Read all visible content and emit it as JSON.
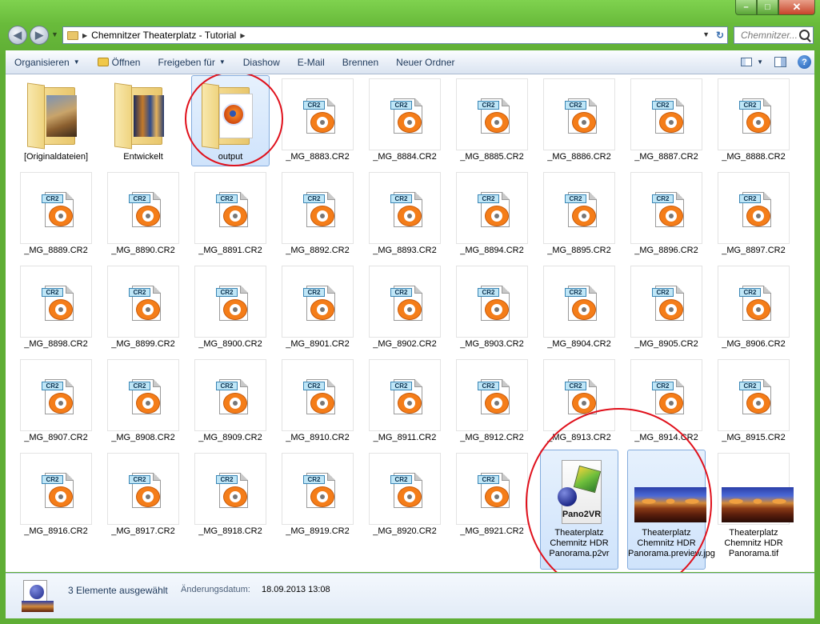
{
  "window": {
    "min_icon": "minimize-icon",
    "max_icon": "maximize-icon",
    "close_icon": "close-icon"
  },
  "nav": {
    "breadcrumb": [
      "Chemnitzer Theaterplatz - Tutorial"
    ],
    "search_placeholder": "Chemnitzer..."
  },
  "toolbar": {
    "items": [
      {
        "label": "Organisieren",
        "caret": true
      },
      {
        "label": "Öffnen",
        "icon": "open-icon"
      },
      {
        "label": "Freigeben für",
        "caret": true
      },
      {
        "label": "Diashow"
      },
      {
        "label": "E-Mail"
      },
      {
        "label": "Brennen"
      },
      {
        "label": "Neuer Ordner"
      }
    ],
    "help": "?"
  },
  "files": [
    {
      "label": "[Originaldateien]",
      "type": "folder-photo"
    },
    {
      "label": "Entwickelt",
      "type": "folder-photo-dark"
    },
    {
      "label": "output",
      "type": "folder-firefox",
      "selected": true
    },
    {
      "label": "_MG_8883.CR2",
      "type": "cr2"
    },
    {
      "label": "_MG_8884.CR2",
      "type": "cr2"
    },
    {
      "label": "_MG_8885.CR2",
      "type": "cr2"
    },
    {
      "label": "_MG_8886.CR2",
      "type": "cr2"
    },
    {
      "label": "_MG_8887.CR2",
      "type": "cr2"
    },
    {
      "label": "_MG_8888.CR2",
      "type": "cr2"
    },
    {
      "label": "_MG_8889.CR2",
      "type": "cr2"
    },
    {
      "label": "_MG_8890.CR2",
      "type": "cr2"
    },
    {
      "label": "_MG_8891.CR2",
      "type": "cr2"
    },
    {
      "label": "_MG_8892.CR2",
      "type": "cr2"
    },
    {
      "label": "_MG_8893.CR2",
      "type": "cr2"
    },
    {
      "label": "_MG_8894.CR2",
      "type": "cr2"
    },
    {
      "label": "_MG_8895.CR2",
      "type": "cr2"
    },
    {
      "label": "_MG_8896.CR2",
      "type": "cr2"
    },
    {
      "label": "_MG_8897.CR2",
      "type": "cr2"
    },
    {
      "label": "_MG_8898.CR2",
      "type": "cr2"
    },
    {
      "label": "_MG_8899.CR2",
      "type": "cr2"
    },
    {
      "label": "_MG_8900.CR2",
      "type": "cr2"
    },
    {
      "label": "_MG_8901.CR2",
      "type": "cr2"
    },
    {
      "label": "_MG_8902.CR2",
      "type": "cr2"
    },
    {
      "label": "_MG_8903.CR2",
      "type": "cr2"
    },
    {
      "label": "_MG_8904.CR2",
      "type": "cr2"
    },
    {
      "label": "_MG_8905.CR2",
      "type": "cr2"
    },
    {
      "label": "_MG_8906.CR2",
      "type": "cr2"
    },
    {
      "label": "_MG_8907.CR2",
      "type": "cr2"
    },
    {
      "label": "_MG_8908.CR2",
      "type": "cr2"
    },
    {
      "label": "_MG_8909.CR2",
      "type": "cr2"
    },
    {
      "label": "_MG_8910.CR2",
      "type": "cr2"
    },
    {
      "label": "_MG_8911.CR2",
      "type": "cr2"
    },
    {
      "label": "_MG_8912.CR2",
      "type": "cr2"
    },
    {
      "label": "_MG_8913.CR2",
      "type": "cr2"
    },
    {
      "label": "_MG_8914.CR2",
      "type": "cr2"
    },
    {
      "label": "_MG_8915.CR2",
      "type": "cr2"
    },
    {
      "label": "_MG_8916.CR2",
      "type": "cr2"
    },
    {
      "label": "_MG_8917.CR2",
      "type": "cr2"
    },
    {
      "label": "_MG_8918.CR2",
      "type": "cr2"
    },
    {
      "label": "_MG_8919.CR2",
      "type": "cr2"
    },
    {
      "label": "_MG_8920.CR2",
      "type": "cr2"
    },
    {
      "label": "_MG_8921.CR2",
      "type": "cr2"
    },
    {
      "label": "Theaterplatz Chemnitz HDR Panorama.p2vr",
      "type": "p2vr",
      "selected": true,
      "badge": "Pano2VR"
    },
    {
      "label": "Theaterplatz Chemnitz HDR Panorama.preview.jpg",
      "type": "pano-jpg",
      "selected": true
    },
    {
      "label": "Theaterplatz Chemnitz HDR Panorama.tif",
      "type": "pano-tif"
    }
  ],
  "details": {
    "count": "3 Elemente ausgewählt",
    "date_label": "Änderungsdatum:",
    "date_value": "18.09.2013 13:08"
  },
  "colors": {
    "highlight_circle": "#e0101b",
    "selection_fill": "#cfe3fb",
    "cr2_orange": "#f47d19",
    "window_frame": "#69bb3b"
  }
}
